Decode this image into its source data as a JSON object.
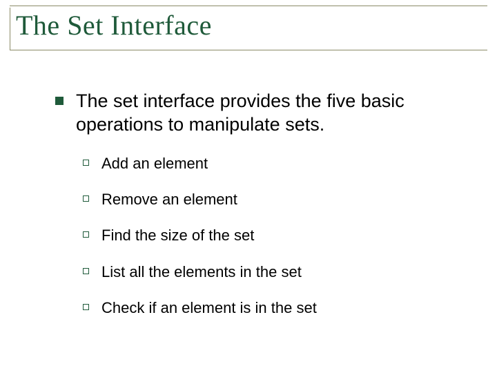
{
  "slide": {
    "title": "The Set Interface",
    "point": "The set interface provides the five basic operations to manipulate sets.",
    "subpoints": [
      "Add an element",
      "Remove an element",
      "Find the size of the set",
      "List all the elements in the set",
      "Check if an element is in the set"
    ]
  }
}
